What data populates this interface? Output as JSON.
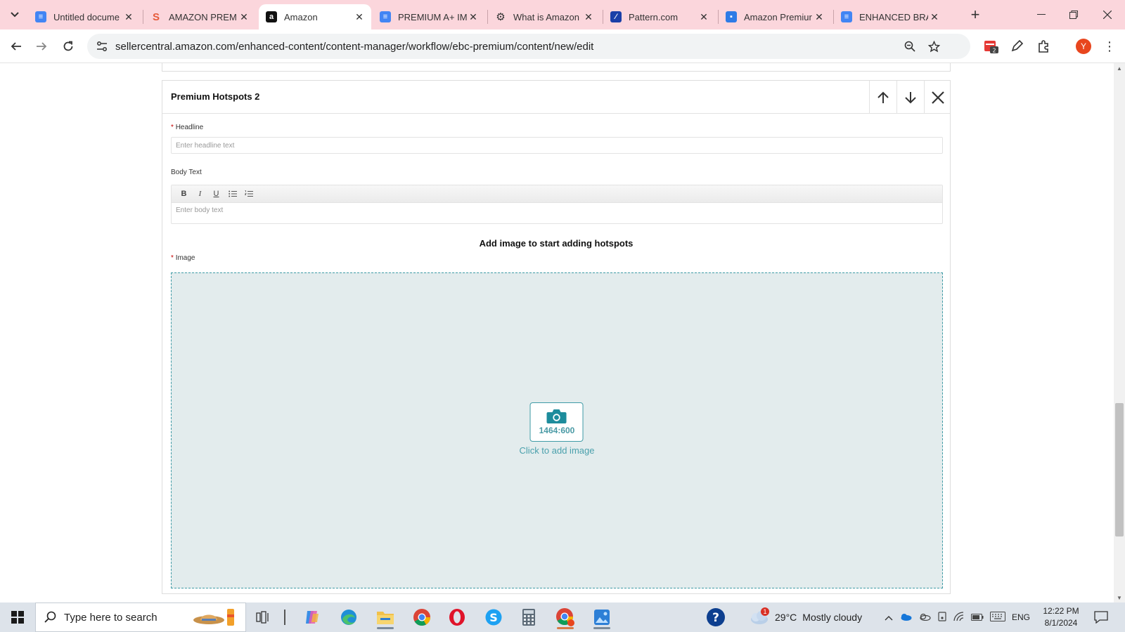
{
  "browser": {
    "tabs": [
      {
        "title": "Untitled docume",
        "icon": "google-docs-icon",
        "active": false
      },
      {
        "title": "AMAZON PREM",
        "icon": "s-logo-icon",
        "active": false
      },
      {
        "title": "Amazon",
        "icon": "amazon-icon",
        "active": true
      },
      {
        "title": "PREMIUM A+ IM",
        "icon": "google-docs-icon",
        "active": false
      },
      {
        "title": "What is Amazon",
        "icon": "gear-site-icon",
        "active": false
      },
      {
        "title": "Pattern.com",
        "icon": "pattern-icon",
        "active": false
      },
      {
        "title": "Amazon Premiur",
        "icon": "blog-icon",
        "active": false
      },
      {
        "title": "ENHANCED BRA",
        "icon": "google-docs-icon",
        "active": false
      }
    ],
    "url": "sellercentral.amazon.com/enhanced-content/content-manager/workflow/ebc-premium/content/new/edit",
    "profile_initial": "Y",
    "extension_badge": "2"
  },
  "module": {
    "title": "Premium Hotspots 2",
    "headline_label": "Headline",
    "headline_placeholder": "Enter headline text",
    "required_mark": "*",
    "body_label": "Body Text",
    "body_placeholder": "Enter body text",
    "toolbar": {
      "bold": "B",
      "italic": "I",
      "underline": "U"
    },
    "hotspot_message": "Add image to start adding hotspots",
    "image_label": "Image",
    "image_ratio": "1464:600",
    "image_cta": "Click to add image"
  },
  "taskbar": {
    "search_placeholder": "Type here to search",
    "weather_temp": "29°C",
    "weather_desc": "Mostly cloudy",
    "weather_alert": "1",
    "language": "ENG",
    "time": "12:22 PM",
    "date": "8/1/2024"
  },
  "colors": {
    "tabstrip": "#fbd6dc",
    "dropzone_bg": "#e3eced",
    "dropzone_border": "#3f9ba6",
    "required": "#c40000"
  }
}
